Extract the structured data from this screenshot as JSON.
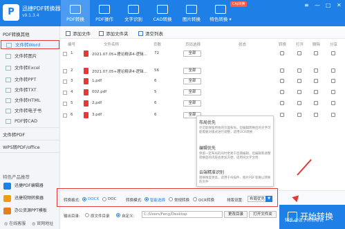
{
  "app": {
    "name": "迅捷PDF转换器",
    "version": "v9.1.3.4",
    "vip_badge": "CAJ转换"
  },
  "nav": [
    {
      "label": "PDF转换",
      "active": true
    },
    {
      "label": "PDF操作",
      "active": false
    },
    {
      "label": "文字识别",
      "active": false
    },
    {
      "label": "CAD转换",
      "active": false
    },
    {
      "label": "图片转换",
      "active": false
    },
    {
      "label": "特色转换 ▾",
      "active": false
    }
  ],
  "window_controls": {
    "min": "—",
    "max": "□",
    "close": "✕",
    "menu": "≡"
  },
  "sidebar": {
    "group1_title": "PDF转换其他",
    "group1_items": [
      "文件转Word",
      "文件转图片",
      "文件转Excel",
      "文件转PPT",
      "文件转TXT",
      "文件转HTML",
      "文件转电子书",
      "PDF转CAD"
    ],
    "group2_title": "文件转PDF",
    "group3_title": "WPS转PDF/office",
    "promo_title": "特色产品推荐",
    "promo_items": [
      "迅捷PDF编辑器",
      "迅捷视频转换器",
      "办公资源PPT模板"
    ],
    "footer": [
      "在线客服",
      "官网地址"
    ]
  },
  "toolbar": {
    "add_file": "添加文件",
    "add_folder": "添加文件夹",
    "clear_list": "清空列表"
  },
  "table": {
    "headers": {
      "num": "编号",
      "name": "文件名称",
      "pages": "页数",
      "page_select": "页码选择",
      "status": "状态",
      "convert": "转换",
      "open": "打开",
      "delete": "删除",
      "share": "分享"
    },
    "rows": [
      {
        "num": "1",
        "name": "2021.07.05+理论精讲4-逻辑...",
        "pages": "72",
        "select": "全部"
      },
      {
        "num": "2",
        "name": "2021.07.05+理论精讲4-逻辑...",
        "pages": "56",
        "select": "全部"
      },
      {
        "num": "3",
        "name": "1.pdf",
        "pages": "6",
        "select": "全部"
      },
      {
        "num": "4",
        "name": "002.pdf",
        "pages": "5",
        "select": "全部"
      },
      {
        "num": "5",
        "name": "2.pdf",
        "pages": "6",
        "select": "全部"
      },
      {
        "num": "6",
        "name": "3.pdf",
        "pages": "6",
        "select": "全部"
      }
    ]
  },
  "popup": {
    "opt1_title": "布局优先",
    "opt1_desc": "尽可能保留原始的页面布局，但编辑转换后的文字可能需要对版式进行调整，适用OCR转换",
    "opt2_title": "编辑优先",
    "opt2_desc": "保留一定布局的同时更易于后期编辑，但编辑和调整转换后的内容会更加方便，适用纯文字文档",
    "opt3_title": "云端精准识别",
    "opt3_desc": "转换精度更高，适用于扫描件、图片PDF等难以转换的文件"
  },
  "options": {
    "format_label": "转换格式:",
    "format_docx": "DOCX",
    "format_doc": "DOC",
    "mode_label": "转换模式:",
    "mode_auto": "智能选择",
    "mode_normal": "常规转换",
    "mode_ocr": "OCR转换",
    "layout_label": "排版设置:",
    "layout_value": "布局优先"
  },
  "output": {
    "label": "输出目录:",
    "opt1": "原文件目录",
    "opt2": "自定义:",
    "path": "C:/Users/Feng/Desktop",
    "change_btn": "更改目录",
    "open_btn": "打开文件夹"
  },
  "convert_button": "开始转换",
  "watermark": "知乎 @这子的日常说"
}
